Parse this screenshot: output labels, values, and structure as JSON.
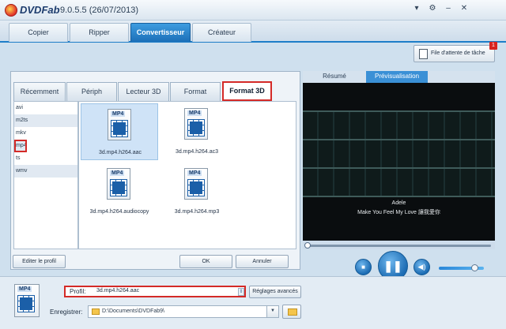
{
  "app": {
    "name": "DVDFab",
    "version": "9.0.5.5 (26/07/2013)"
  },
  "window_controls": [
    "▾",
    "⚙",
    "–",
    "✕"
  ],
  "main_tabs": [
    {
      "label": "Copier"
    },
    {
      "label": "Ripper"
    },
    {
      "label": "Convertisseur",
      "active": true
    },
    {
      "label": "Créateur"
    }
  ],
  "task_queue": {
    "label": "File d'attente de tâche",
    "badge": "1"
  },
  "sub_tabs": [
    {
      "label": "Récemment"
    },
    {
      "label": "Périph"
    },
    {
      "label": "Lecteur 3D"
    },
    {
      "label": "Format"
    },
    {
      "label": "Format 3D",
      "active": true
    }
  ],
  "formats": [
    "avi",
    "m2ts",
    "mkv",
    "mp4",
    "ts",
    "wmv"
  ],
  "selected_format": "mp4",
  "profiles": [
    {
      "type": "MP4",
      "label": "3d.mp4.h264.aac",
      "selected": true
    },
    {
      "type": "MP4",
      "label": "3d.mp4.h264.ac3"
    },
    {
      "type": "MP4",
      "label": "3d.mp4.h264.audiocopy"
    },
    {
      "type": "MP4",
      "label": "3d.mp4.h264.mp3"
    }
  ],
  "buttons": {
    "edit_profile": "Editer le profil",
    "ok": "OK",
    "cancel": "Annuler",
    "advanced": "Réglages avancés"
  },
  "preview": {
    "tabs": [
      {
        "label": "Résumé"
      },
      {
        "label": "Prévisualisation",
        "active": true
      }
    ],
    "subtitle_line1": "Adele",
    "subtitle_line2": "Make You Feel My Love 讓我愛你",
    "playback_progress": 0,
    "volume": 0.85
  },
  "bottom": {
    "file_type": "MP4",
    "profile_label": "Profil:",
    "profile_value": "3d.mp4.h264.aac",
    "save_label": "Enregistrer:",
    "save_path": "D:\\Documents\\DVDFab9\\"
  },
  "colors": {
    "accent": "#1e7ec8",
    "highlight": "#d42a27"
  }
}
